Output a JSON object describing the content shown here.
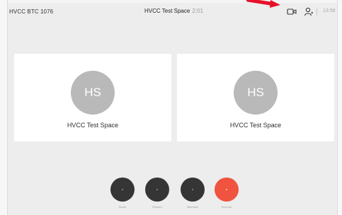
{
  "topbar": {
    "device_name": "HVCC BTC 1076",
    "space_title": "HVCC Test Space",
    "duration": "2:01",
    "clock": "13:58",
    "icons": [
      "camera-icon",
      "person-icon"
    ]
  },
  "participants": [
    {
      "initials": "HS",
      "name": "HVCC Test Space"
    },
    {
      "initials": "HS",
      "name": "HVCC Test Space"
    }
  ],
  "controls": [
    {
      "label": "Share",
      "icon": "share-icon"
    },
    {
      "label": "Present",
      "icon": "present-icon"
    },
    {
      "label": "Minimize",
      "icon": "minimize-icon"
    },
    {
      "label": "End call",
      "icon": "end-call-icon"
    }
  ],
  "colors": {
    "background": "#ededed",
    "tile": "#ffffff",
    "avatar": "#b9b9b9",
    "control": "#353535",
    "end_call": "#f0533f",
    "annotation_arrow": "#e8102a"
  }
}
